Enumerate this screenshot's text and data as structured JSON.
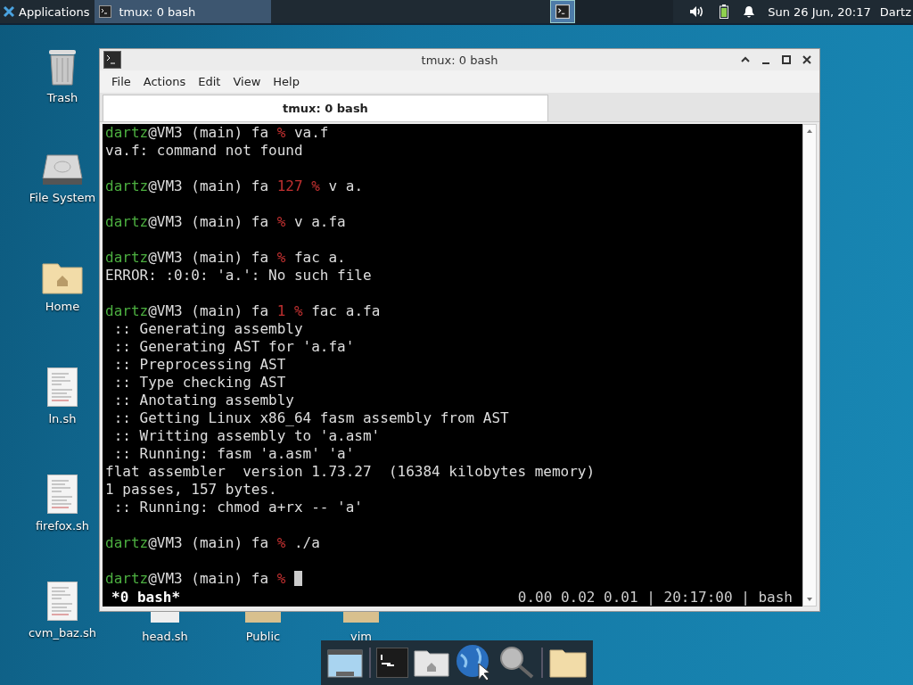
{
  "panel": {
    "menu_label": "Applications",
    "tasks": [
      {
        "title": "tmux: 0 bash",
        "selected": true
      }
    ],
    "clock": "Sun 26 Jun, 20:17",
    "user": "Dartz"
  },
  "desktop_icons": [
    {
      "label": "Trash",
      "kind": "trash"
    },
    {
      "label": "File System",
      "kind": "drive"
    },
    {
      "label": "Home",
      "kind": "home"
    },
    {
      "label": "ln.sh",
      "kind": "script"
    },
    {
      "label": "firefox.sh",
      "kind": "script"
    },
    {
      "label": "cvm_baz.sh",
      "kind": "script"
    }
  ],
  "bottom_icons": [
    {
      "label": "head.sh",
      "kind": "script"
    },
    {
      "label": "Public",
      "kind": "folder"
    },
    {
      "label": "vim",
      "kind": "folder"
    }
  ],
  "window": {
    "title": "tmux: 0 bash",
    "menu": [
      "File",
      "Actions",
      "Edit",
      "View",
      "Help"
    ],
    "tabs": [
      {
        "label": "tmux: 0 bash",
        "selected": true
      }
    ],
    "lines": [
      {
        "kind": "prompt",
        "user": "dartz",
        "host": "@VM3 (main) fa ",
        "symbol": "%",
        "command": " va.f",
        "cursor": false
      },
      {
        "kind": "output",
        "text": "va.f: command not found"
      },
      {
        "kind": "blank"
      },
      {
        "kind": "prompt",
        "user": "dartz",
        "host": "@VM3 (main) fa ",
        "status": "127 ",
        "symbol": "%",
        "command": " v a.",
        "cursor": false
      },
      {
        "kind": "blank"
      },
      {
        "kind": "prompt",
        "user": "dartz",
        "host": "@VM3 (main) fa ",
        "symbol": "%",
        "command": " v a.fa",
        "cursor": false
      },
      {
        "kind": "blank"
      },
      {
        "kind": "prompt",
        "user": "dartz",
        "host": "@VM3 (main) fa ",
        "symbol": "%",
        "command": " fac a.",
        "cursor": false
      },
      {
        "kind": "output",
        "text": "ERROR: :0:0: 'a.': No such file"
      },
      {
        "kind": "blank"
      },
      {
        "kind": "prompt",
        "user": "dartz",
        "host": "@VM3 (main) fa ",
        "status": "1 ",
        "symbol": "%",
        "command": " fac a.fa",
        "cursor": false
      },
      {
        "kind": "output",
        "text": " :: Generating assembly"
      },
      {
        "kind": "output",
        "text": " :: Generating AST for 'a.fa'"
      },
      {
        "kind": "output",
        "text": " :: Preprocessing AST"
      },
      {
        "kind": "output",
        "text": " :: Type checking AST"
      },
      {
        "kind": "output",
        "text": " :: Anotating assembly"
      },
      {
        "kind": "output",
        "text": " :: Getting Linux x86_64 fasm assembly from AST"
      },
      {
        "kind": "output",
        "text": " :: Writting assembly to 'a.asm'"
      },
      {
        "kind": "output",
        "text": " :: Running: fasm 'a.asm' 'a'"
      },
      {
        "kind": "output",
        "text": "flat assembler  version 1.73.27  (16384 kilobytes memory)"
      },
      {
        "kind": "output",
        "text": "1 passes, 157 bytes."
      },
      {
        "kind": "output",
        "text": " :: Running: chmod a+rx -- 'a'"
      },
      {
        "kind": "blank"
      },
      {
        "kind": "prompt",
        "user": "dartz",
        "host": "@VM3 (main) fa ",
        "symbol": "%",
        "command": " ./a",
        "cursor": false
      },
      {
        "kind": "blank"
      },
      {
        "kind": "prompt",
        "user": "dartz",
        "host": "@VM3 (main) fa ",
        "symbol": "%",
        "cursor": true
      }
    ],
    "status_left": "*0 bash*",
    "status_right": "0.00 0.02 0.01 | 20:17:00 | bash"
  }
}
